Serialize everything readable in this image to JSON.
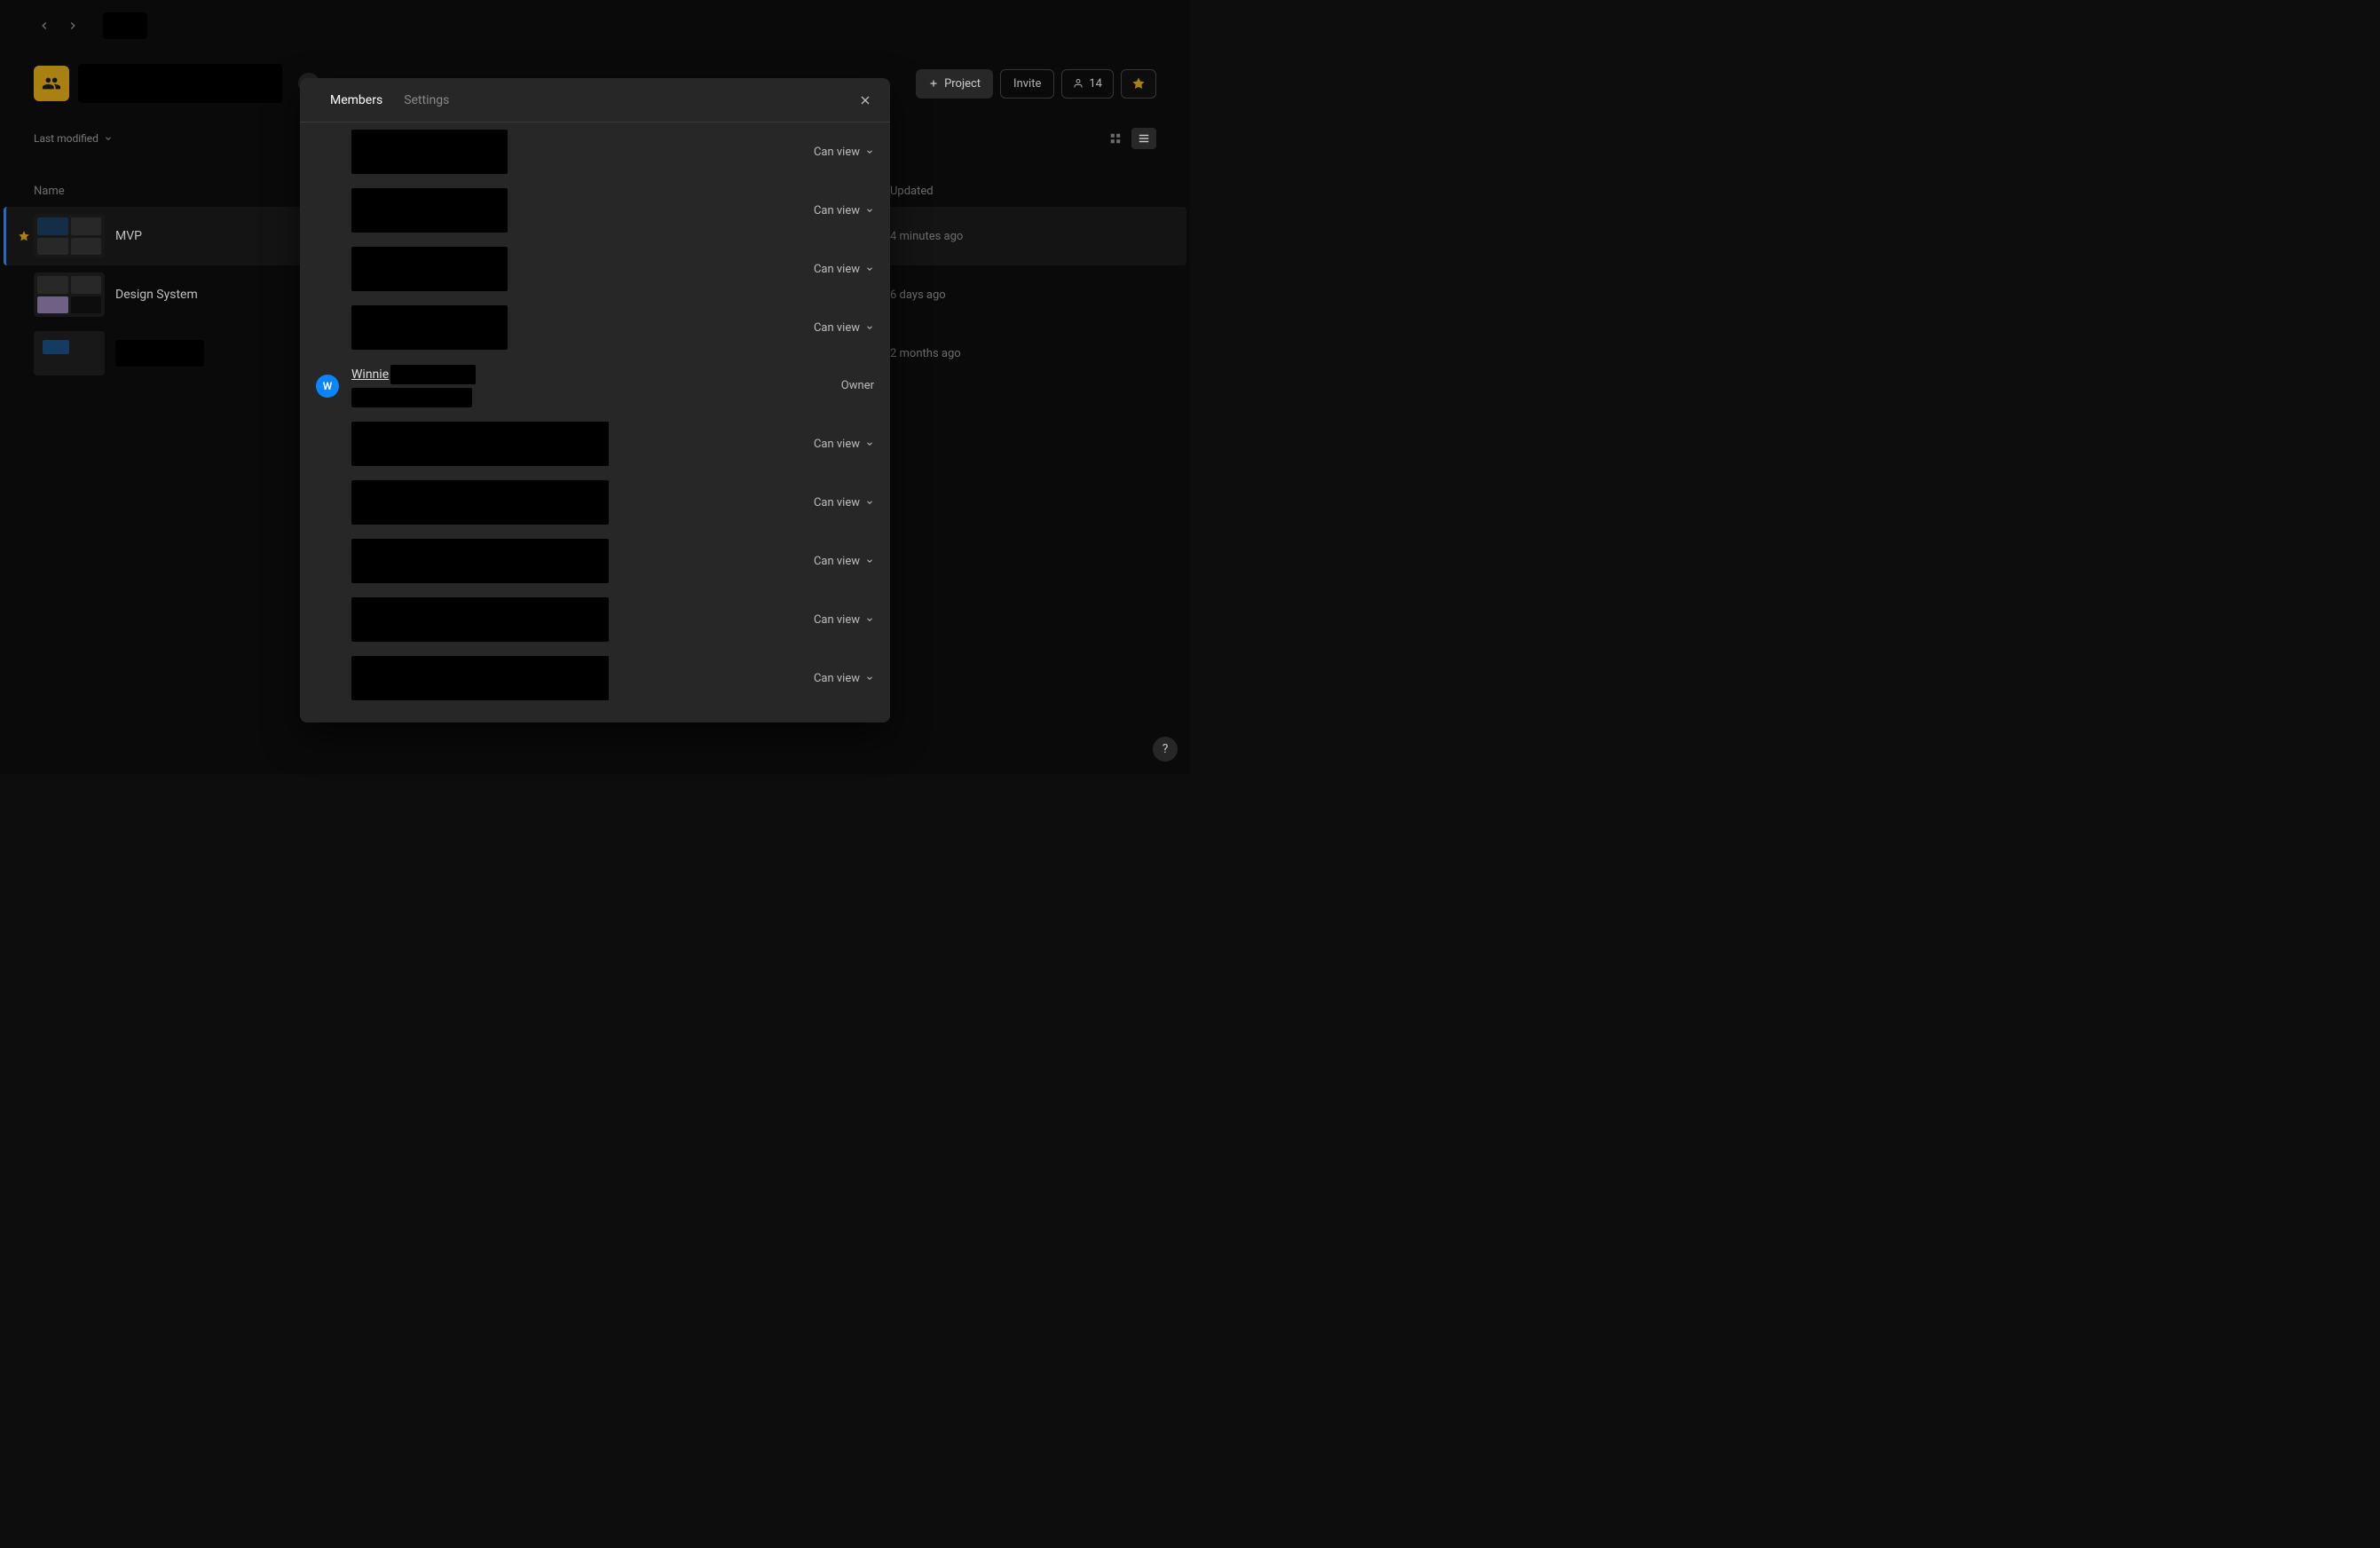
{
  "header": {
    "sort_label": "Last modified",
    "project_button": "Project",
    "invite_button": "Invite",
    "member_count": "14",
    "columns": {
      "name": "Name",
      "updated": "Updated"
    }
  },
  "files": [
    {
      "name": "MVP",
      "updated": "4 minutes ago",
      "starred": true,
      "selected": true,
      "thumb_style": "grid-dark"
    },
    {
      "name": "Design System",
      "updated": "6 days ago",
      "starred": false,
      "selected": false,
      "thumb_style": "grid-purple"
    },
    {
      "name": "",
      "updated": "2 months ago",
      "starred": false,
      "selected": false,
      "thumb_style": "single"
    }
  ],
  "modal": {
    "tabs": {
      "members": "Members",
      "settings": "Settings"
    },
    "active_tab": "Members",
    "permission_label": "Can view",
    "owner_label": "Owner",
    "members": [
      {
        "perm": "Can view"
      },
      {
        "perm": "Can view"
      },
      {
        "perm": "Can view"
      },
      {
        "perm": "Can view"
      },
      {
        "name_prefix": "Winnie",
        "initial": "W",
        "perm": "Owner",
        "is_owner": true
      },
      {
        "perm": "Can view"
      },
      {
        "perm": "Can view"
      },
      {
        "perm": "Can view"
      },
      {
        "perm": "Can view"
      },
      {
        "perm": "Can view"
      }
    ]
  },
  "help_label": "?"
}
